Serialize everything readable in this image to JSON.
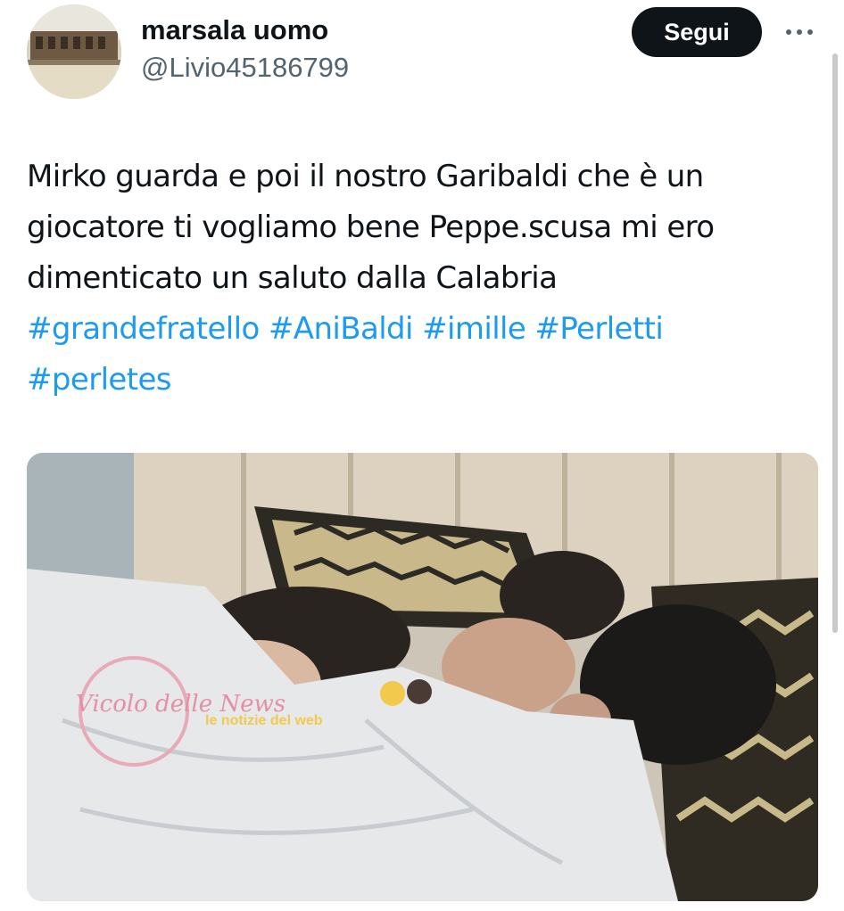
{
  "user": {
    "display_name": "marsala uomo",
    "handle": "@Livio45186799",
    "avatar_icon": "profile-photo"
  },
  "actions": {
    "follow_label": "Segui",
    "more_icon": "more-horizontal-icon"
  },
  "tweet": {
    "text_lines": [
      "Mirko guarda e poi il nostro Garibaldi che è un",
      "giocatore ti vogliamo bene Peppe.scusa mi ero",
      "dimenticato un saluto dalla Calabria"
    ],
    "hashtags": [
      "#grandefratello",
      "#AniBaldi",
      "#imille",
      "#Perletti",
      "#perletes"
    ]
  },
  "media": {
    "watermark_text": "Vicolo delle News",
    "watermark_text_2": "le notizie del web"
  },
  "colors": {
    "link": "#1d9bf0",
    "text": "#0f1419",
    "secondary": "#536471",
    "button_bg": "#0f1419",
    "button_text": "#ffffff"
  }
}
